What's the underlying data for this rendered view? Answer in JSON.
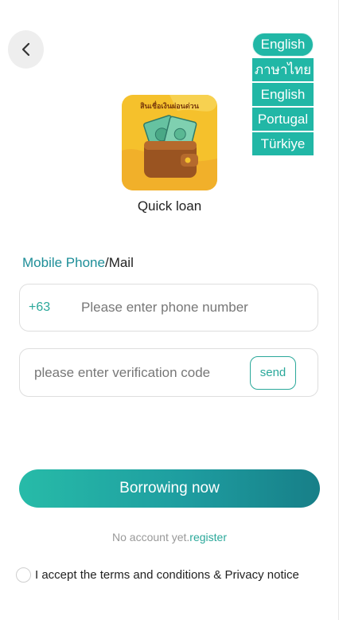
{
  "header": {
    "back_icon": "chevron-left-icon"
  },
  "languages": {
    "current": "English",
    "options": [
      "ภาษาไทย",
      "English",
      "Portugal",
      "Türkiye"
    ]
  },
  "app": {
    "logo_text": "สินเชื่อเงินผ่อนด่วน",
    "name": "Quick loan"
  },
  "form": {
    "label_accent": "Mobile Phone",
    "label_rest": "/Mail",
    "country_code": "+63",
    "phone_placeholder": "Please enter phone number",
    "code_placeholder": "please enter verification code",
    "send_label": "send"
  },
  "actions": {
    "borrow_label": "Borrowing now",
    "no_account_text": "No account yet.",
    "register_label": "register"
  },
  "agreement": {
    "text": "I accept the terms and conditions & Privacy notice"
  },
  "colors": {
    "accent": "#21b7a6",
    "link": "#1d8e98",
    "logo_bg": "#f5c12c"
  }
}
